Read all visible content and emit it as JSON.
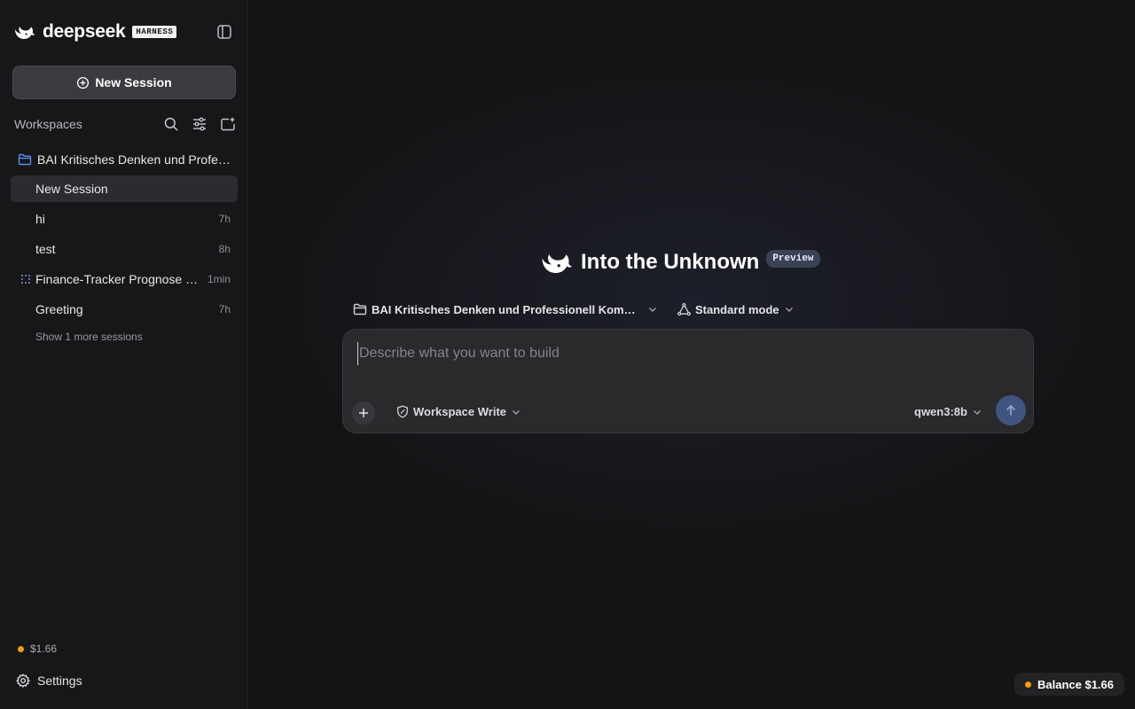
{
  "brand": {
    "name": "deepseek",
    "badge": "HARNESS"
  },
  "sidebar": {
    "new_session_label": "New Session",
    "workspaces_title": "Workspaces",
    "workspace": {
      "label": "BAI Kritisches Denken und Professionell Kommunizieren"
    },
    "sessions": [
      {
        "title": "New Session",
        "time": "",
        "active": true
      },
      {
        "title": "hi",
        "time": "7h"
      },
      {
        "title": "test",
        "time": "8h"
      },
      {
        "title": "Finance-Tracker Prognose erstellen",
        "time": "1min",
        "running": true
      },
      {
        "title": "Greeting",
        "time": "7h"
      }
    ],
    "more_sessions": "Show 1 more sessions",
    "balance": "$1.66",
    "settings_label": "Settings"
  },
  "main": {
    "hero_title": "Into the Unknown",
    "preview_badge": "Preview",
    "workspace_selector": "BAI Kritisches Denken und Professionell Kommunizieren",
    "mode_selector": "Standard mode",
    "composer": {
      "placeholder": "Describe what you want to build",
      "value": "",
      "permission": "Workspace Write",
      "model": "qwen3:8b"
    },
    "balance_pill": "Balance $1.66"
  },
  "colors": {
    "accent_send": "#3f5580",
    "balance_dot": "#f59e0b",
    "workspace_folder": "#5b8def",
    "preview_badge_bg": "#3a4256"
  },
  "icons": {
    "brand": "whale-logo-icon",
    "sidebar_toggle": "sidebar-toggle-icon",
    "new_session": "plus-circle-icon",
    "search": "search-icon",
    "filter": "sliders-icon",
    "new_folder": "folder-plus-icon",
    "workspace": "folder-icon",
    "running": "spinner-icon",
    "settings": "gear-icon",
    "mode": "triangle-cycle-icon",
    "permission": "shield-pen-icon",
    "attach": "plus-icon",
    "send": "arrow-up-icon"
  }
}
